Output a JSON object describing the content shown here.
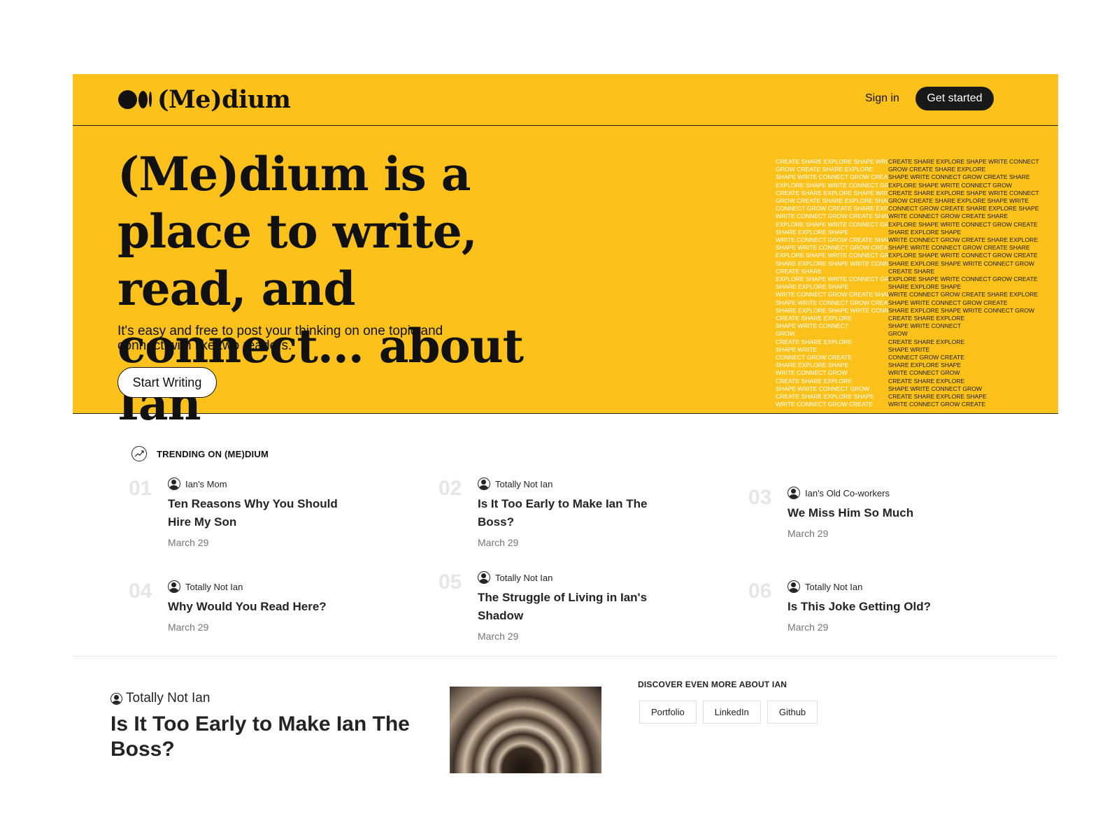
{
  "header": {
    "logo_text": "(Me)dium",
    "signin_label": "Sign in",
    "getstarted_label": "Get started"
  },
  "hero": {
    "title": "(Me)dium is a place to write, read, and connect... about Ian",
    "subtitle": "It's easy and free to post your thinking on one topic and connect with like two readers.",
    "cta_label": "Start Writing",
    "word_art_left": [
      "CREATE SHARE EXPLORE SHAPE WRITE CONNECT",
      "GROW CREATE SHARE EXPLORE",
      "SHAPE WRITE CONNECT GROW CREATE SHARE",
      "EXPLORE SHAPE WRITE CONNECT GROW",
      "CREATE SHARE EXPLORE SHAPE WRITE CONNECT",
      "GROW CREATE SHARE EXPLORE SHAPE WRITE",
      "CONNECT GROW CREATE SHARE EXPLORE SHAPE",
      "WRITE CONNECT GROW CREATE SHARE",
      "EXPLORE SHAPE WRITE CONNECT GROW CREATE",
      "SHARE EXPLORE SHAPE",
      "WRITE CONNECT GROW CREATE SHARE EXPLORE",
      "SHAPE WRITE CONNECT GROW CREATE SHARE",
      "EXPLORE SHAPE WRITE CONNECT GROW CREATE",
      "SHARE EXPLORE SHAPE WRITE CONNECT GROW",
      "CREATE SHARE",
      "EXPLORE SHAPE WRITE CONNECT GROW CREATE",
      "SHARE EXPLORE SHAPE",
      "WRITE CONNECT GROW CREATE SHARE EXPLORE",
      "SHAPE WRITE CONNECT GROW CREATE",
      "SHARE EXPLORE SHAPE WRITE CONNECT GROW",
      "CREATE SHARE EXPLORE",
      "SHAPE WRITE CONNECT",
      "GROW",
      "CREATE SHARE EXPLORE",
      "SHAPE WRITE",
      "CONNECT GROW CREATE",
      "SHARE EXPLORE SHAPE",
      "WRITE CONNECT GROW",
      "CREATE SHARE EXPLORE",
      "SHAPE WRITE CONNECT GROW",
      "CREATE SHARE EXPLORE SHAPE",
      "WRITE CONNECT GROW CREATE"
    ],
    "word_art_right": [
      "CREATE SHARE EXPLORE SHAPE WRITE CONNECT",
      "GROW CREATE SHARE EXPLORE",
      "SHAPE WRITE CONNECT GROW CREATE SHARE",
      "EXPLORE SHAPE WRITE CONNECT GROW",
      "CREATE SHARE EXPLORE SHAPE WRITE CONNECT",
      "GROW CREATE SHARE EXPLORE SHAPE WRITE",
      "CONNECT GROW CREATE SHARE EXPLORE SHAPE",
      "WRITE CONNECT GROW CREATE SHARE",
      "EXPLORE SHAPE WRITE CONNECT GROW CREATE",
      "SHARE EXPLORE SHAPE",
      "WRITE CONNECT GROW CREATE SHARE EXPLORE",
      "SHAPE WRITE CONNECT GROW CREATE SHARE",
      "EXPLORE SHAPE WRITE CONNECT GROW CREATE",
      "SHARE EXPLORE SHAPE WRITE CONNECT GROW",
      "CREATE SHARE",
      "EXPLORE SHAPE WRITE CONNECT GROW CREATE",
      "SHARE EXPLORE SHAPE",
      "WRITE CONNECT GROW CREATE SHARE EXPLORE",
      "SHAPE WRITE CONNECT GROW CREATE",
      "SHARE EXPLORE SHAPE WRITE CONNECT GROW",
      "CREATE SHARE EXPLORE",
      "SHAPE WRITE CONNECT",
      "GROW",
      "CREATE SHARE EXPLORE",
      "SHAPE WRITE",
      "CONNECT GROW CREATE",
      "SHARE EXPLORE SHAPE",
      "WRITE CONNECT GROW",
      "CREATE SHARE EXPLORE",
      "SHAPE WRITE CONNECT GROW",
      "CREATE SHARE EXPLORE SHAPE",
      "WRITE CONNECT GROW CREATE"
    ]
  },
  "trending": {
    "label": "TRENDING ON (ME)DIUM",
    "items": [
      {
        "num": "01",
        "author": "Ian's Mom",
        "title": "Ten Reasons Why You Should Hire My Son",
        "date": "March 29"
      },
      {
        "num": "02",
        "author": "Totally Not Ian",
        "title": "Is It Too Early to Make Ian The Boss?",
        "date": "March 29"
      },
      {
        "num": "03",
        "author": "Ian's Old Co-workers",
        "title": "We Miss Him So Much",
        "date": "March 29"
      },
      {
        "num": "04",
        "author": "Totally Not Ian",
        "title": "Why Would You Read Here?",
        "date": "March 29"
      },
      {
        "num": "05",
        "author": "Totally Not Ian",
        "title": "The Struggle of Living in Ian's Shadow",
        "date": "March 29"
      },
      {
        "num": "06",
        "author": "Totally Not Ian",
        "title": "Is This Joke Getting Old?",
        "date": "March 29"
      }
    ]
  },
  "feature": {
    "author": "Totally Not Ian",
    "title": "Is It Too Early to Make Ian The Boss?"
  },
  "discover": {
    "label": "DISCOVER EVEN MORE ABOUT IAN",
    "tags": [
      "Portfolio",
      "LinkedIn",
      "Github"
    ]
  },
  "colors": {
    "brand_yellow": "#fcc21b",
    "dark": "#191919",
    "muted_number": "#e6e6e6"
  }
}
